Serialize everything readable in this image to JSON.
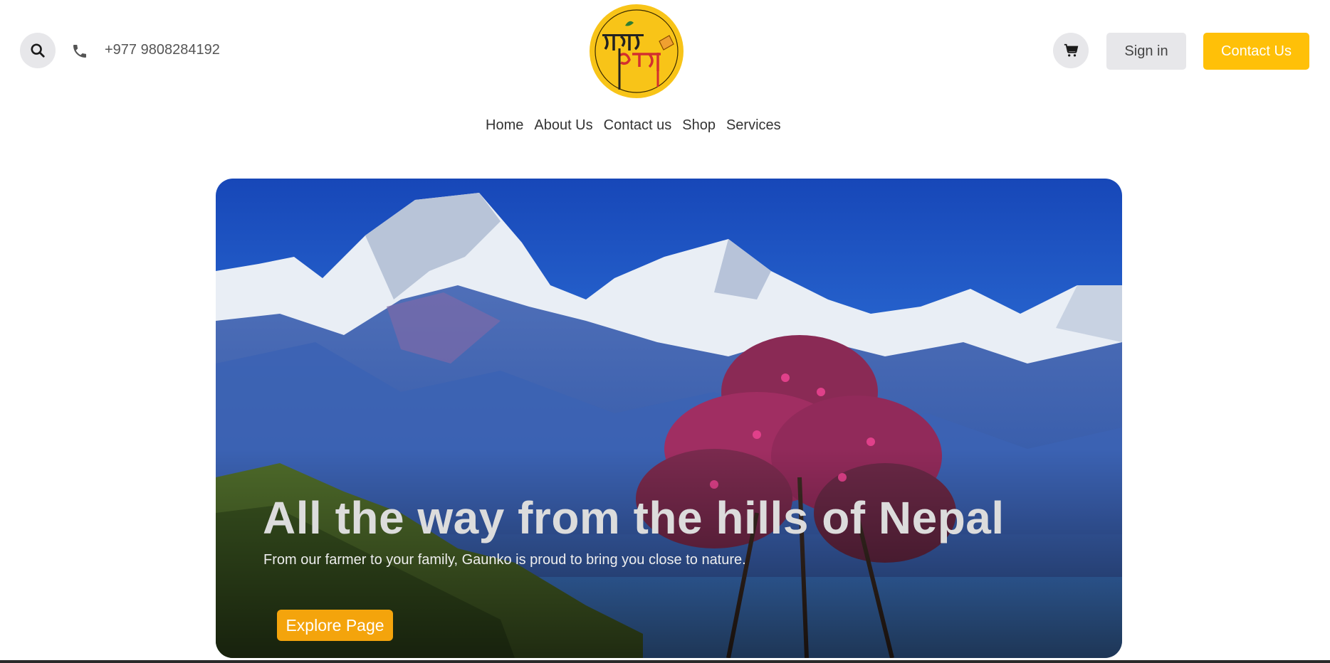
{
  "header": {
    "phone": "+977 9808284192",
    "logo_alt": "Gaunko Achar logo",
    "signin_label": "Sign in",
    "contact_label": "Contact Us",
    "icons": {
      "search": "search-icon",
      "phone": "phone-icon",
      "cart": "cart-icon"
    }
  },
  "nav": {
    "items": [
      "Home",
      "About Us",
      "Contact us",
      "Shop",
      "Services"
    ]
  },
  "hero": {
    "title": "All the way from the hills of Nepal",
    "subtitle": "From our farmer to your family, Gaunko is proud to bring you close to nature.",
    "cta_label": "Explore Page"
  },
  "colors": {
    "accent": "#ffc008",
    "cta": "#f4a40c",
    "icon_bg": "#e7e7ea"
  }
}
